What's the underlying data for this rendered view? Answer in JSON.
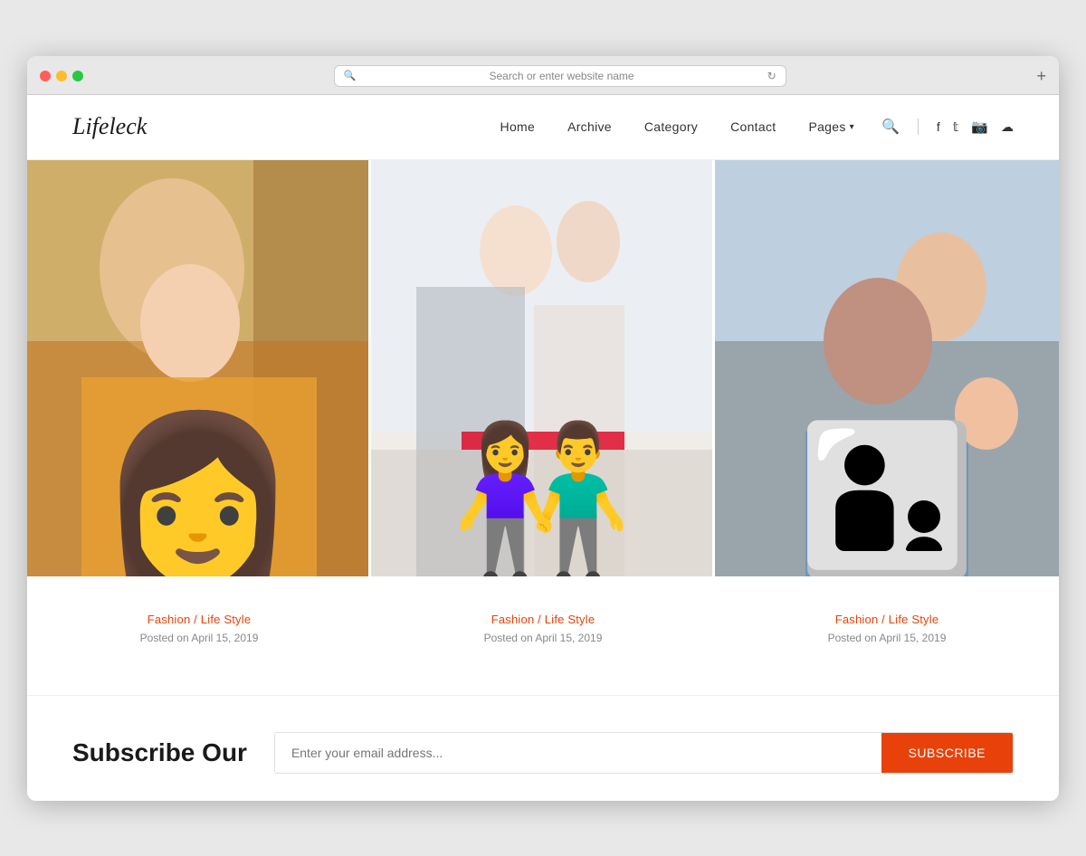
{
  "browser": {
    "address_placeholder": "Search or enter website name",
    "new_tab_label": "+"
  },
  "nav": {
    "logo": "Lifeleck",
    "links": [
      {
        "id": "home",
        "label": "Home"
      },
      {
        "id": "archive",
        "label": "Archive"
      },
      {
        "id": "category",
        "label": "Category"
      },
      {
        "id": "contact",
        "label": "Contact"
      },
      {
        "id": "pages",
        "label": "Pages"
      }
    ],
    "social_icons": [
      "f",
      "t",
      "i",
      "s"
    ]
  },
  "posts": [
    {
      "id": "post-1",
      "category": "Fashion / Life Style",
      "date": "Posted on April 15, 2019",
      "img_alt": "Woman in yellow sweater by red car"
    },
    {
      "id": "post-2",
      "category": "Fashion / Life Style",
      "date": "Posted on April 15, 2019",
      "img_alt": "Couple at car dealership"
    },
    {
      "id": "post-3",
      "category": "Fashion / Life Style",
      "date": "Posted on April 15, 2019",
      "img_alt": "Father and son playing"
    }
  ],
  "subscribe": {
    "title": "Subscribe Our",
    "input_placeholder": "Enter your email address...",
    "button_label": "SUBSCRIBE"
  },
  "colors": {
    "accent": "#e8420a",
    "text_primary": "#1a1a1a",
    "text_secondary": "#888888"
  }
}
